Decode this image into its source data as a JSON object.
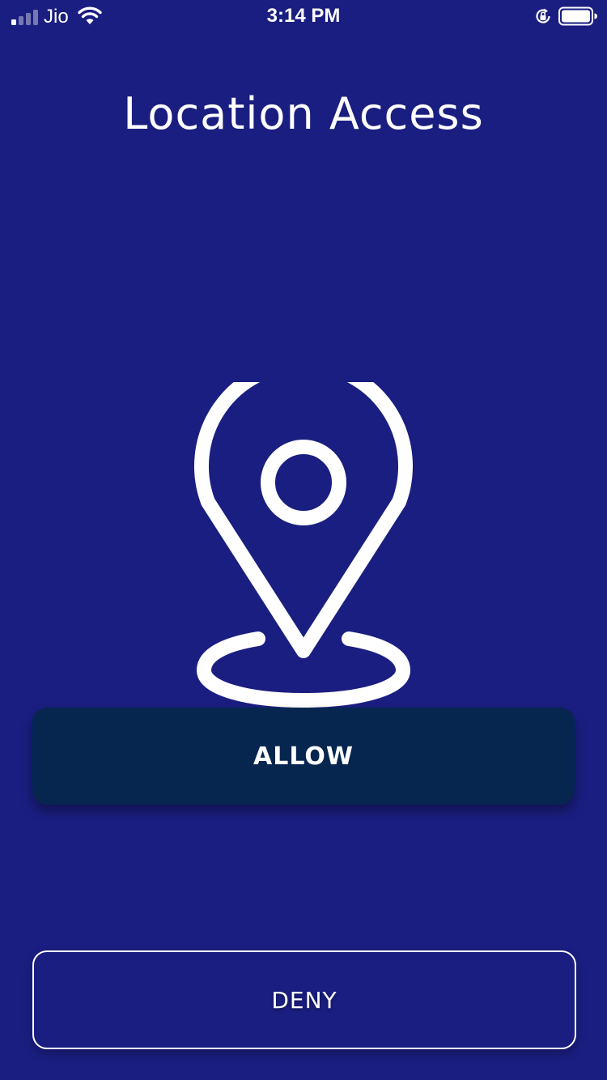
{
  "status_bar": {
    "carrier": "Jio",
    "time": "3:14 PM",
    "icons": [
      "signal-icon",
      "wifi-icon",
      "orientation-lock-icon",
      "battery-icon"
    ]
  },
  "page": {
    "title": "Location Access",
    "illustration": "location-pin-icon"
  },
  "buttons": {
    "allow_label": "ALLOW",
    "deny_label": "DENY"
  },
  "colors": {
    "background": "#1a1e80",
    "allow_button": "#06264f",
    "foreground": "#ffffff"
  }
}
